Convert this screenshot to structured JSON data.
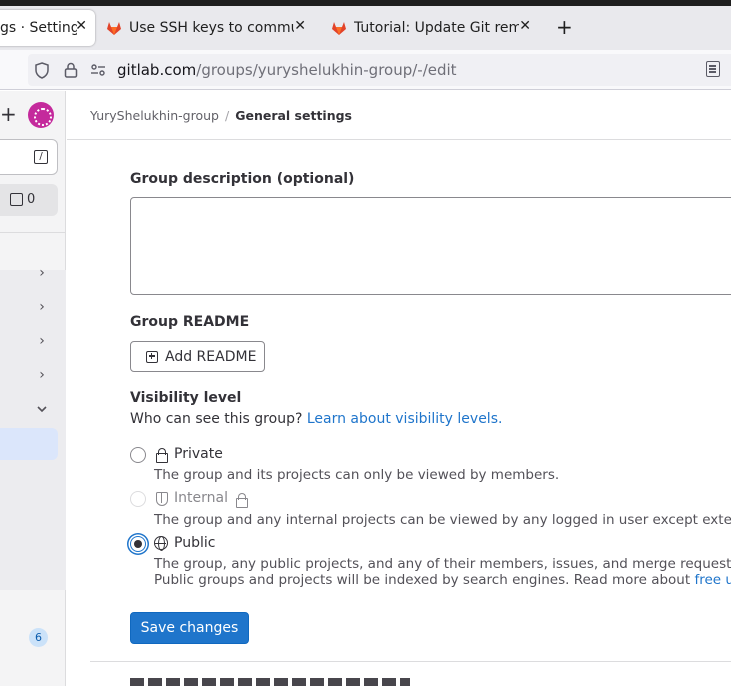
{
  "browser": {
    "tabs": [
      {
        "title": "gs · Settings · ",
        "active": true
      },
      {
        "title": "Use SSH keys to communi",
        "active": false
      },
      {
        "title": "Tutorial: Update Git remo",
        "active": false
      }
    ],
    "new_tab_icon": "plus-icon",
    "close_icon": "close-icon",
    "url": {
      "host": "gitlab.com",
      "path": "/groups/yuryshelukhin-group/-/edit"
    }
  },
  "sidebar": {
    "search_shortcut": "/",
    "todo_count": "0",
    "nav_badge": "6"
  },
  "breadcrumb": {
    "group": "YuryShelukhin-group",
    "separator": "/",
    "current": "General settings"
  },
  "form": {
    "description_label": "Group description (optional)",
    "description_value": "",
    "readme_label": "Group README",
    "add_readme_button": "Add README",
    "visibility_label": "Visibility level",
    "visibility_help": "Who can see this group?",
    "visibility_help_link": "Learn about visibility levels.",
    "visibility_options": [
      {
        "title": "Private",
        "icon": "lock-icon",
        "checked": false,
        "disabled": false,
        "description": "The group and its projects can only be viewed by members."
      },
      {
        "title": "Internal",
        "icon": "shield-icon",
        "checked": false,
        "disabled": true,
        "description": "The group and any internal projects can be viewed by any logged in user except extern"
      },
      {
        "title": "Public",
        "icon": "globe-icon",
        "checked": true,
        "disabled": false,
        "description": "The group, any public projects, and any of their members, issues, and merge requests c",
        "description2": "Public groups and projects will be indexed by search engines. Read more about",
        "description2_link": "free us"
      }
    ],
    "save_button": "Save changes"
  },
  "colors": {
    "accent": "#1f75cb",
    "brand_avatar": "#c42a9c"
  }
}
